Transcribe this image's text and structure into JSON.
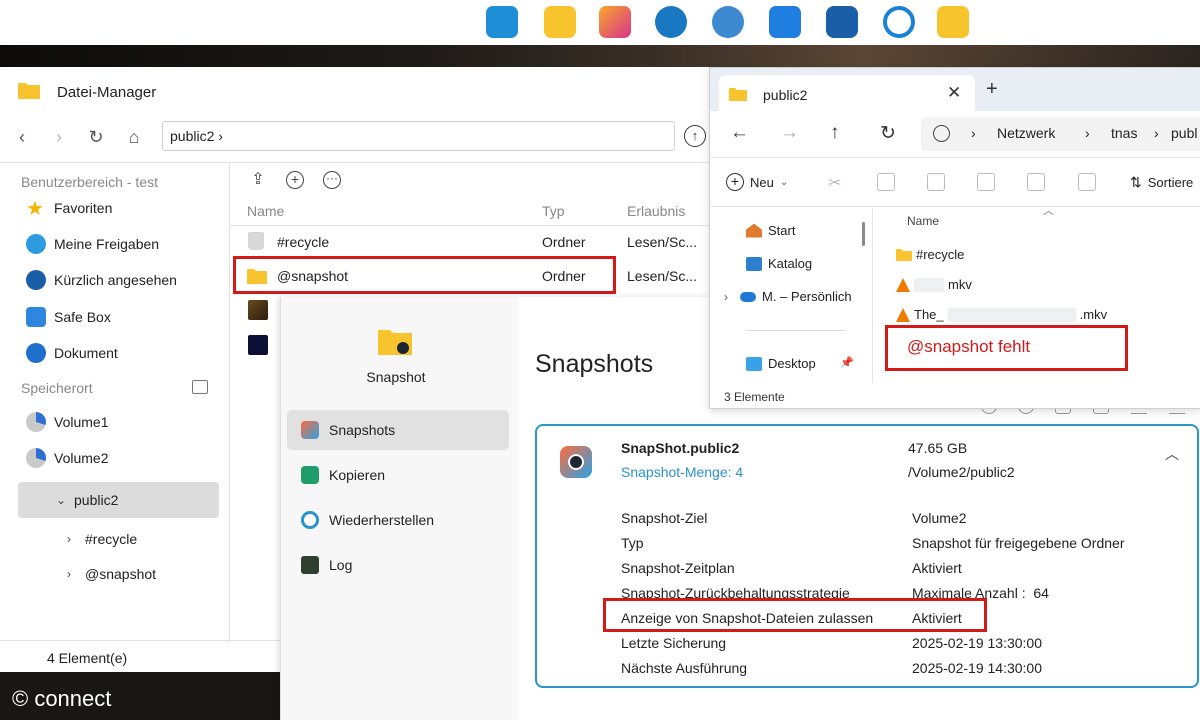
{
  "dock": {
    "icons": [
      "qts-home-icon",
      "folder-icon",
      "photo-app-icon",
      "clock-icon",
      "gear-icon",
      "app-center-icon",
      "container-icon",
      "helpdesk-icon",
      "file-station-icon"
    ]
  },
  "file_manager": {
    "title": "Datei-Manager",
    "path": "public2 ›",
    "sidebar": {
      "section_user": "Benutzerbereich - test",
      "items": [
        "Favoriten",
        "Meine Freigaben",
        "Kürzlich angesehen",
        "Safe Box",
        "Dokument"
      ],
      "section_storage": "Speicherort",
      "volumes": [
        "Volume1",
        "Volume2"
      ],
      "folder": "public2",
      "subfolders": [
        "#recycle",
        "@snapshot"
      ]
    },
    "columns": {
      "name": "Name",
      "type": "Typ",
      "permission": "Erlaubnis"
    },
    "rows": [
      {
        "name": "#recycle",
        "type": "Ordner",
        "permission": "Lesen/Sc..."
      },
      {
        "name": "@snapshot",
        "type": "Ordner",
        "permission": "Lesen/Sc..."
      }
    ],
    "status": "4 Element(e)"
  },
  "snapshot_app": {
    "app_name": "Snapshot",
    "nav": [
      "Snapshots",
      "Kopieren",
      "Wiederherstellen",
      "Log"
    ],
    "title": "Snapshots",
    "card": {
      "name": "SnapShot.public2",
      "size": "47.65 GB",
      "count_link": "Snapshot-Menge: 4",
      "path": "/Volume2/public2",
      "details": [
        {
          "label": "Snapshot-Ziel",
          "value": "Volume2"
        },
        {
          "label": "Typ",
          "value": "Snapshot für freigegebene Ordner"
        },
        {
          "label": "Snapshot-Zeitplan",
          "value": "Aktiviert"
        },
        {
          "label": "Snapshot-Zurückbehaltungsstrategie",
          "value": "Maximale Anzahl :  64"
        },
        {
          "label": "Anzeige von Snapshot-Dateien zulassen",
          "value": "Aktiviert"
        },
        {
          "label": "Letzte Sicherung",
          "value": "2025-02-19 13:30:00"
        },
        {
          "label": "Nächste Ausführung",
          "value": "2025-02-19 14:30:00"
        }
      ]
    }
  },
  "explorer": {
    "tab_title": "public2",
    "breadcrumb": [
      "›",
      "Netzwerk",
      "›",
      "tnas",
      "›",
      "publ"
    ],
    "new_label": "Neu",
    "sort_label": "Sortiere",
    "nav_pane": [
      "Start",
      "Katalog",
      "M. – Persönlich",
      "Desktop"
    ],
    "column_name": "Name",
    "files": [
      {
        "name": "#recycle",
        "suffix": ""
      },
      {
        "name": "",
        "suffix": "mkv"
      },
      {
        "name": "The_",
        "suffix": ".mkv"
      }
    ],
    "missing_note": "@snapshot fehlt",
    "status": "3 Elemente"
  },
  "watermark": "© connect",
  "colors": {
    "highlight": "#d41919",
    "accent": "#2a93c9"
  }
}
